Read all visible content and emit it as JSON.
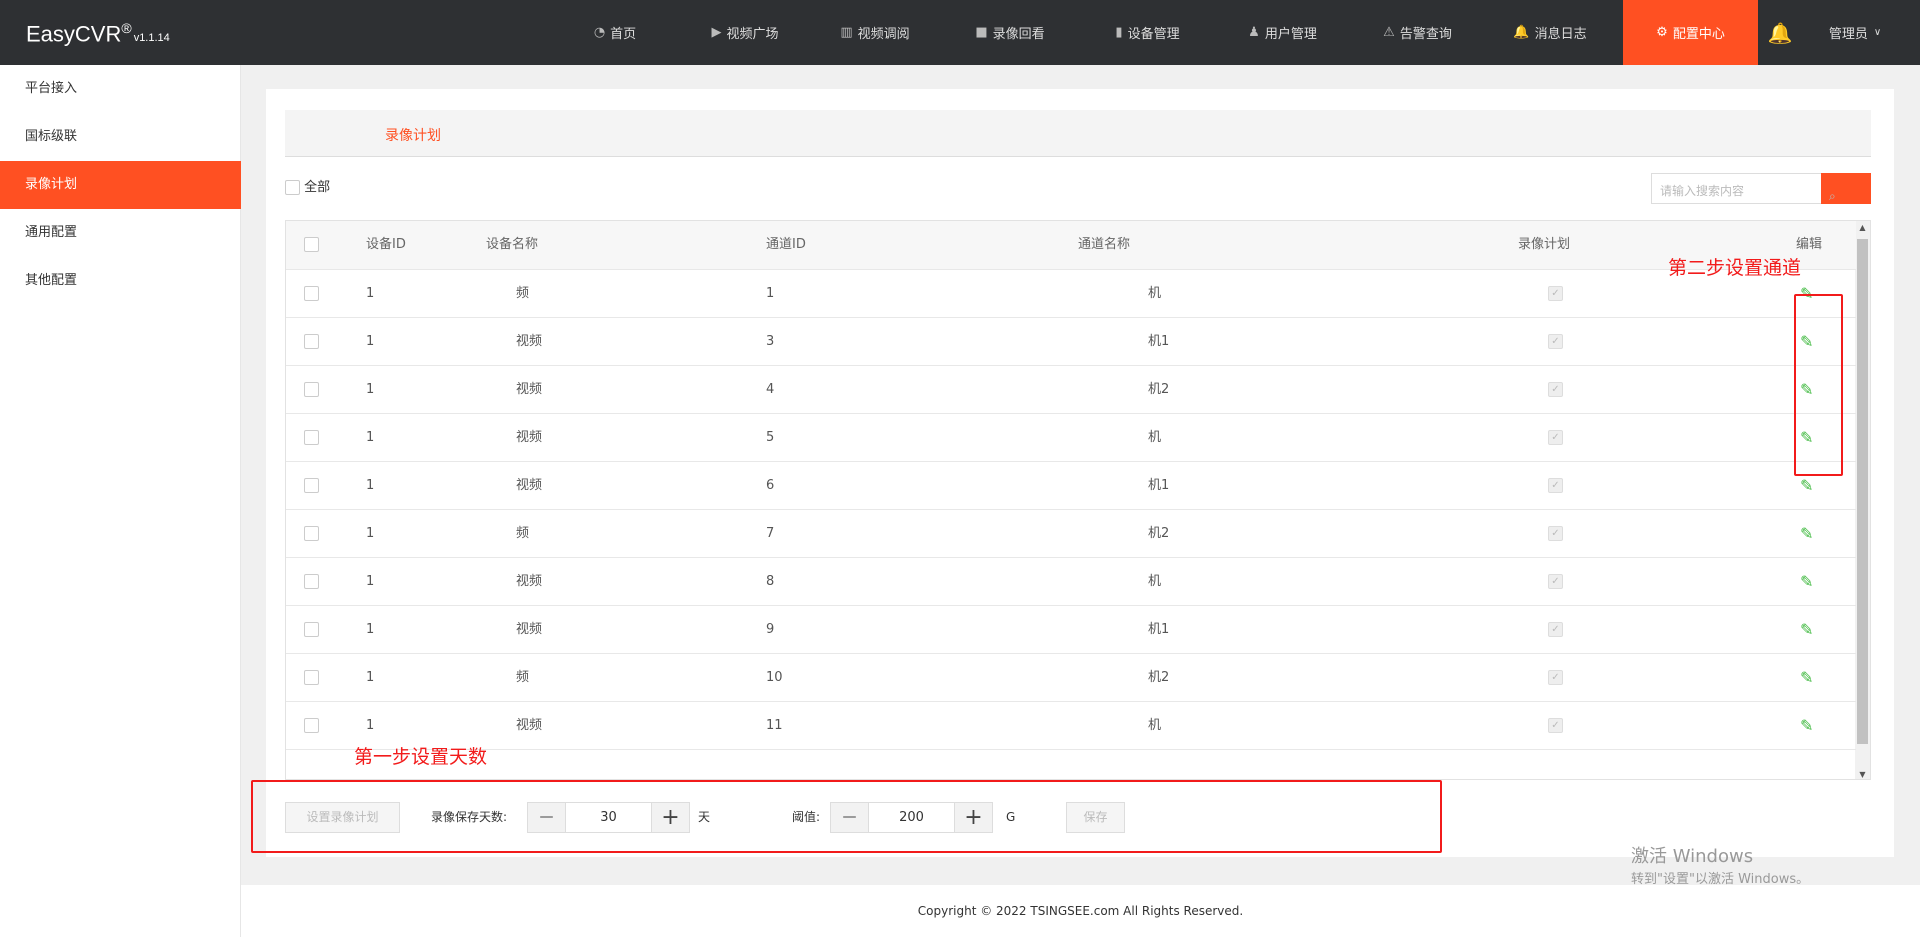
{
  "header": {
    "logo": "EasyCVR",
    "logo_reg": "®",
    "version": "v1.1.14",
    "nav": [
      {
        "label": "首页",
        "icon": "dashboard-icon"
      },
      {
        "label": "视频广场",
        "icon": "play-icon"
      },
      {
        "label": "视频调阅",
        "icon": "grid-icon"
      },
      {
        "label": "录像回看",
        "icon": "video-camera-icon"
      },
      {
        "label": "设备管理",
        "icon": "device-icon"
      },
      {
        "label": "用户管理",
        "icon": "user-icon"
      },
      {
        "label": "告警查询",
        "icon": "alarm-icon"
      },
      {
        "label": "消息日志",
        "icon": "bell-icon"
      },
      {
        "label": "配置中心",
        "icon": "gear-icon",
        "active": true
      }
    ],
    "user": "管理员"
  },
  "sidebar": {
    "items": [
      {
        "label": "平台接入"
      },
      {
        "label": "国标级联"
      },
      {
        "label": "录像计划",
        "active": true
      },
      {
        "label": "通用配置"
      },
      {
        "label": "其他配置"
      }
    ]
  },
  "main": {
    "tab": "录像计划",
    "select_all": "全部",
    "search": {
      "placeholder": "请输入搜索内容"
    },
    "columns": [
      "设备ID",
      "设备名称",
      "通道ID",
      "通道名称",
      "录像计划",
      "编辑"
    ],
    "rows": [
      {
        "device_id": "1",
        "device_name": "频",
        "channel_id": "1",
        "channel_name": "机",
        "plan": true
      },
      {
        "device_id": "1",
        "device_name": "视频",
        "channel_id": "3",
        "channel_name": "机1",
        "plan": true
      },
      {
        "device_id": "1",
        "device_name": "视频",
        "channel_id": "4",
        "channel_name": "机2",
        "plan": true
      },
      {
        "device_id": "1",
        "device_name": "视频",
        "channel_id": "5",
        "channel_name": "机",
        "plan": true
      },
      {
        "device_id": "1",
        "device_name": "视频",
        "channel_id": "6",
        "channel_name": "机1",
        "plan": true
      },
      {
        "device_id": "1",
        "device_name": "频",
        "channel_id": "7",
        "channel_name": "机2",
        "plan": true
      },
      {
        "device_id": "1",
        "device_name": "视频",
        "channel_id": "8",
        "channel_name": "机",
        "plan": true
      },
      {
        "device_id": "1",
        "device_name": "视频",
        "channel_id": "9",
        "channel_name": "机1",
        "plan": true
      },
      {
        "device_id": "1",
        "device_name": "频",
        "channel_id": "10",
        "channel_name": "机2",
        "plan": true
      },
      {
        "device_id": "1",
        "device_name": "视频",
        "channel_id": "11",
        "channel_name": "机",
        "plan": true
      }
    ],
    "bottom": {
      "set_plan": "设置录像计划",
      "days_label": "录像保存天数:",
      "days": "30",
      "days_unit": "天",
      "threshold_label": "阈值:",
      "threshold": "200",
      "threshold_unit": "G",
      "save": "保存",
      "minus": "—",
      "plus": "+"
    }
  },
  "annotations": {
    "step1": "第一步设置天数",
    "step2": "第二步设置通道"
  },
  "footer": {
    "copyright": "Copyright © 2022 TSINGSEE.com All Rights Reserved."
  },
  "watermark": {
    "line1": "激活 Windows",
    "line2": "转到\"设置\"以激活 Windows。"
  },
  "colors": {
    "accent": "#ff5022",
    "header_bg": "#2e3033",
    "annotation": "#f21b1b",
    "edit": "#3fb93f"
  }
}
